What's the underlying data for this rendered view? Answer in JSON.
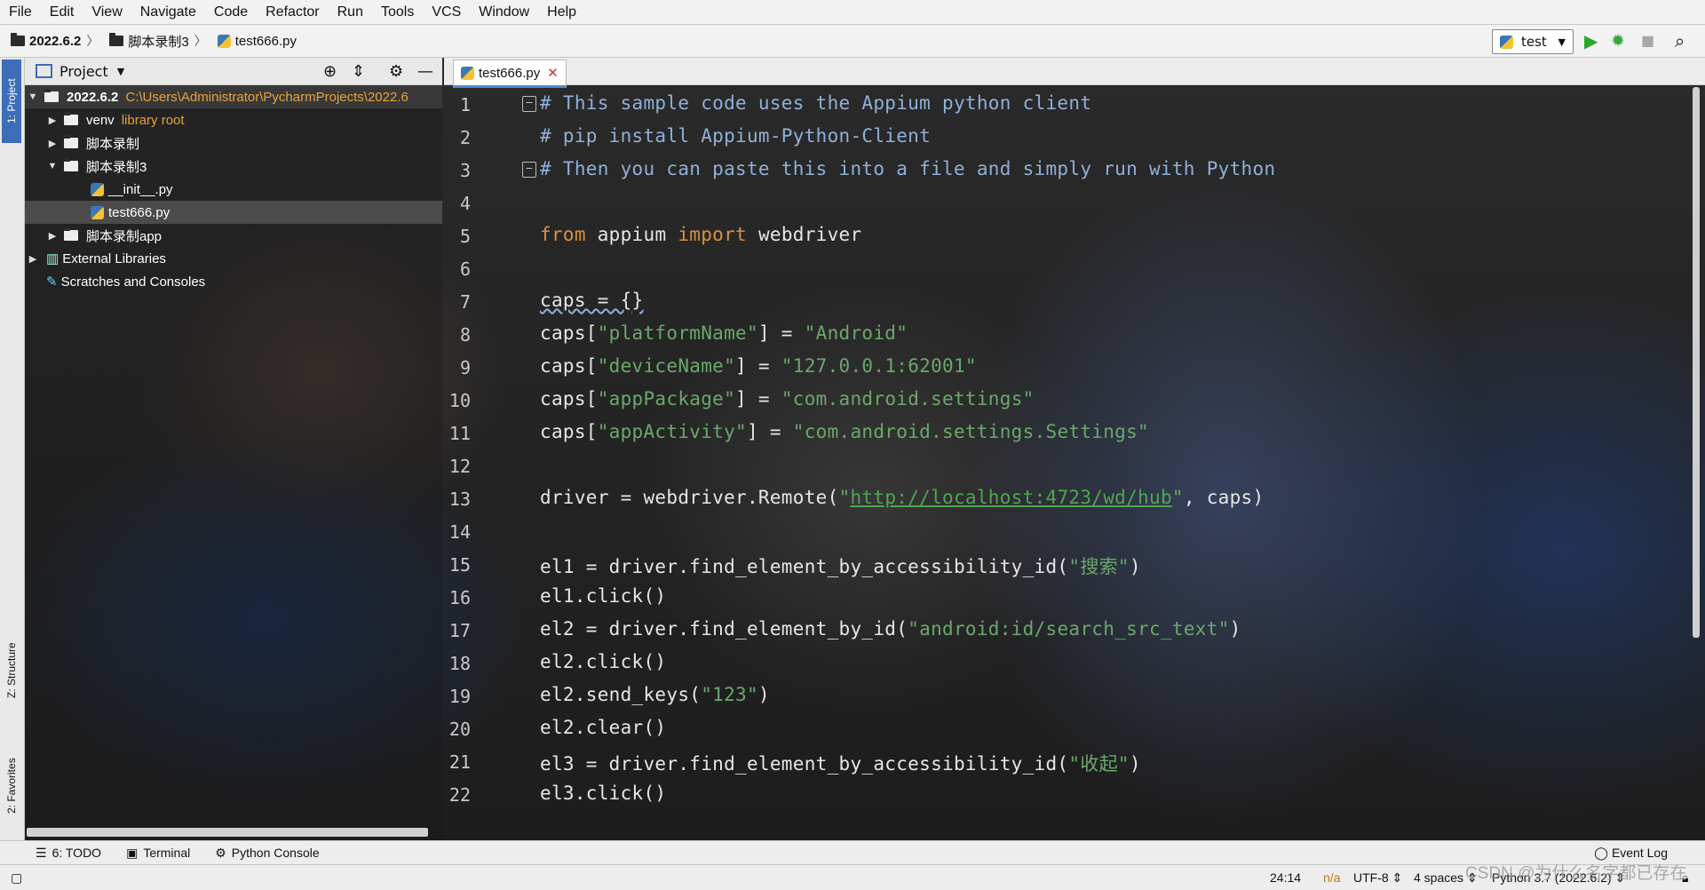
{
  "menu": [
    "File",
    "Edit",
    "View",
    "Navigate",
    "Code",
    "Refactor",
    "Run",
    "Tools",
    "VCS",
    "Window",
    "Help"
  ],
  "breadcrumb": {
    "root": "2022.6.2",
    "folder": "脚本录制3",
    "file": "test666.py"
  },
  "run_config": {
    "label": "test"
  },
  "side_tabs": {
    "project": "1: Project",
    "structure": "Z: Structure",
    "favorites": "2: Favorites"
  },
  "project_panel": {
    "title": "Project",
    "root": {
      "name": "2022.6.2",
      "path": "C:\\Users\\Administrator\\PycharmProjects\\2022.6"
    },
    "items": [
      {
        "name": "venv",
        "note": "library root"
      },
      {
        "name": "脚本录制"
      },
      {
        "name": "脚本录制3"
      },
      {
        "name": "__init__.py"
      },
      {
        "name": "test666.py"
      },
      {
        "name": "脚本录制app"
      },
      {
        "name": "External Libraries"
      },
      {
        "name": "Scratches and Consoles"
      }
    ]
  },
  "editor_tab": {
    "label": "test666.py"
  },
  "code": {
    "line_numbers": [
      "1",
      "2",
      "3",
      "4",
      "5",
      "6",
      "7",
      "8",
      "9",
      "10",
      "11",
      "12",
      "13",
      "14",
      "15",
      "16",
      "17",
      "18",
      "19",
      "20",
      "21",
      "22"
    ],
    "l1": "# This sample code uses the Appium python client",
    "l2": "# pip install Appium-Python-Client",
    "l3": "# Then you can paste this into a file and simply run with Python",
    "l5a": "from",
    "l5b": " appium ",
    "l5c": "import",
    "l5d": " webdriver",
    "l7": "caps = {}",
    "l8a": "caps[",
    "l8b": "\"platformName\"",
    "l8c": "] = ",
    "l8d": "\"Android\"",
    "l9a": "caps[",
    "l9b": "\"deviceName\"",
    "l9c": "] = ",
    "l9d": "\"127.0.0.1:62001\"",
    "l10a": "caps[",
    "l10b": "\"appPackage\"",
    "l10c": "] = ",
    "l10d": "\"com.android.settings\"",
    "l11a": "caps[",
    "l11b": "\"appActivity\"",
    "l11c": "] = ",
    "l11d": "\"com.android.settings.Settings\"",
    "l13a": "driver = webdriver.Remote(",
    "l13q1": "\"",
    "l13url": "http://localhost:4723/wd/hub",
    "l13q2": "\"",
    "l13b": ", caps)",
    "l15a": "el1 = driver.find_element_by_accessibility_id(",
    "l15b": "\"搜索\"",
    "l15c": ")",
    "l16": "el1.click()",
    "l17a": "el2 = driver.find_element_by_id(",
    "l17b": "\"android:id/search_src_text\"",
    "l17c": ")",
    "l18": "el2.click()",
    "l19a": "el2.send_keys(",
    "l19b": "\"123\"",
    "l19c": ")",
    "l20": "el2.clear()",
    "l21a": "el3 = driver.find_element_by_accessibility_id(",
    "l21b": "\"收起\"",
    "l21c": ")",
    "l22": "el3.click()"
  },
  "bottom_tabs": {
    "todo": "6: TODO",
    "terminal": "Terminal",
    "python_console": "Python Console",
    "event_log": "Event Log"
  },
  "status": {
    "position": "24:14",
    "na": "n/a",
    "encoding": "UTF-8 ⇕",
    "indent": "4 spaces ⇕",
    "interpreter": "Python 3.7 (2022.6.2) ⇕"
  },
  "watermark": "CSDN @为什么名字都已存在",
  "colors": {
    "comment": "#8fb0d8",
    "keyword": "#d9913d",
    "string": "#6aa86a",
    "selection": "#3d6db8"
  }
}
